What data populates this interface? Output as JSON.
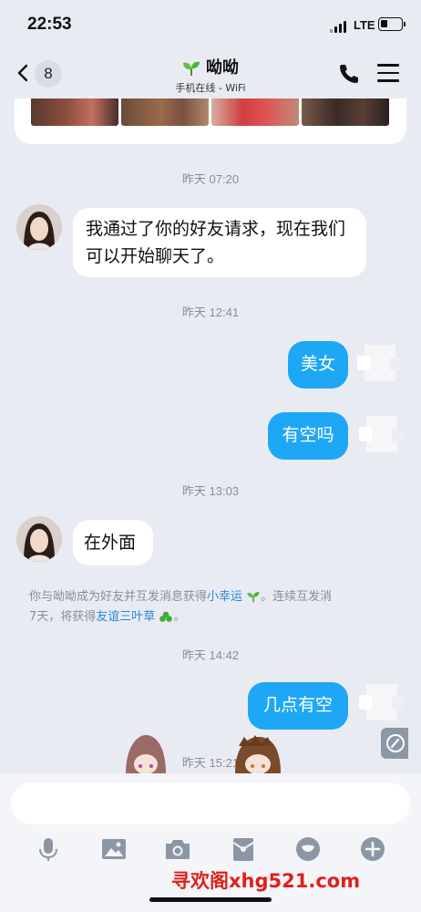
{
  "status_bar": {
    "time": "22:53",
    "network": "LTE"
  },
  "header": {
    "back_count": "8",
    "contact_name": "呦呦",
    "contact_status": "手机在线 - WiFi"
  },
  "messages": {
    "ts1": "昨天 07:20",
    "in1": "我通过了你的好友请求，现在我们可以开始聊天了。",
    "ts2": "昨天 12:41",
    "out1": "美女",
    "out2": "有空吗",
    "ts3": "昨天 13:03",
    "in2": "在外面",
    "ts4": "昨天 14:42",
    "out3": "几点有空",
    "ts5": "昨天 15:21"
  },
  "system_notice": {
    "part1": "你与呦呦成为好友并互发消息获得",
    "link1": "小幸运",
    "part2": "。连续互发消",
    "part3": "7天，将获得",
    "link2": "友谊三叶草",
    "part4": "。"
  },
  "composer": {
    "input_value": ""
  },
  "toolbar": {
    "icons": [
      "microphone-icon",
      "image-icon",
      "camera-icon",
      "red-packet-icon",
      "emoji-icon",
      "plus-icon"
    ]
  },
  "watermark": "寻欢阁xhg521.com",
  "colors": {
    "outgoing_bubble": "#1ea7f5",
    "link": "#2a86d8",
    "background": "#e9ebf3",
    "watermark": "#e0201c"
  }
}
